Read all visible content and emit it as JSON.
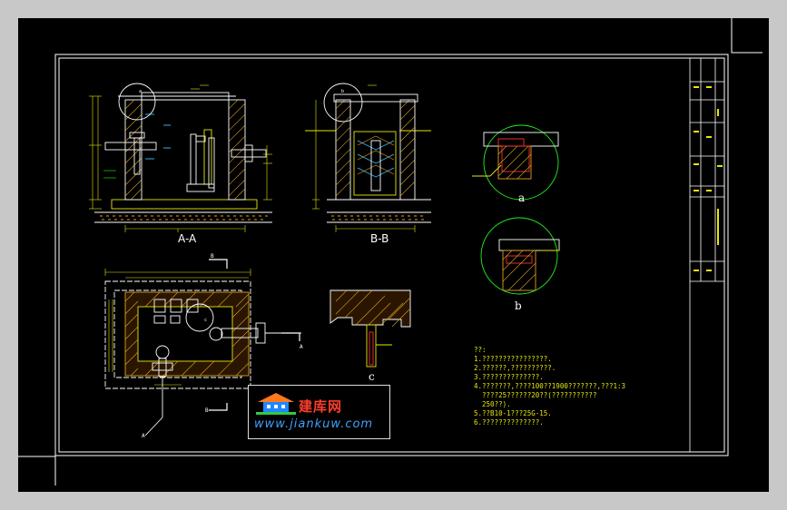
{
  "colors": {
    "background": "#000000",
    "frame": "#ffffff",
    "wall_hatch": "#e0a020",
    "pipe": "#ffffff",
    "dimension": "#e6e60e",
    "section_outline": "#ffffff",
    "detail_circle": "#22ee22",
    "detail_fill": "#ff3030",
    "text_yellow": "#e6e60e",
    "logo_red": "#ff3e2e",
    "logo_blue": "#3fa0ff"
  },
  "views": {
    "section_aa": {
      "label": "A-A"
    },
    "section_bb": {
      "label": "B-B"
    },
    "plan": {
      "cut_a_left": "A",
      "cut_a_right": "A",
      "cut_b_top": "B",
      "cut_b_bottom": "B"
    },
    "detail_a": {
      "label": "a",
      "callout": "a"
    },
    "detail_b": {
      "label": "b",
      "callout": "b"
    },
    "detail_c": {
      "label": "c",
      "callout": "c"
    }
  },
  "notes": {
    "title": "??:",
    "items": [
      "1.????????????????.",
      "2.??????,??????????.",
      "3.??????????????.",
      "4.???????,????100??1900???????,???1:3",
      "  ????25??????20??(???????????",
      "  250??).",
      "5.??B10-1???25G-15.",
      "6.??????????????."
    ]
  },
  "watermark": {
    "site_name": "建库网",
    "url": "www.jiankuw.com",
    "icon": "house-icon"
  }
}
